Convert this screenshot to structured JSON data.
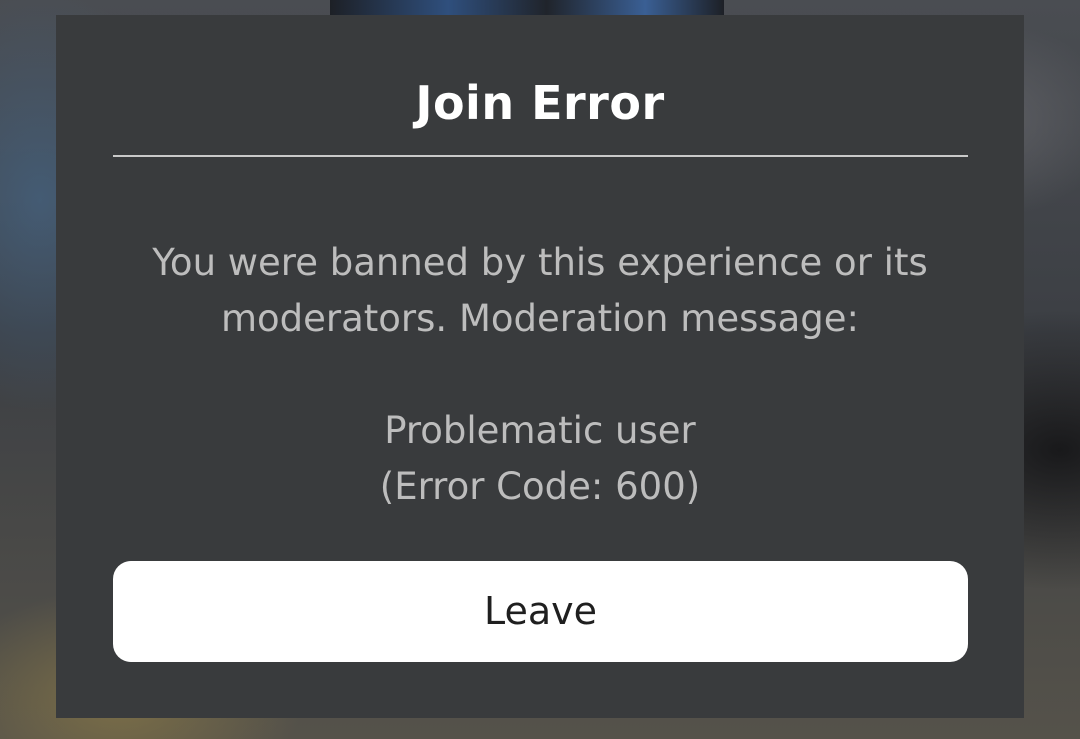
{
  "dialog": {
    "title": "Join Error",
    "message": "You were banned by this experience or its moderators. Moderation message:",
    "moderation_message": "Problematic user",
    "error_code_text": "(Error Code: 600)",
    "leave_label": "Leave"
  },
  "colors": {
    "modal_background": "#393b3d",
    "title_text": "#ffffff",
    "body_text": "#bdbdbd",
    "divider": "#c9c9c9",
    "button_background": "#ffffff",
    "button_text": "#1f1f1f"
  }
}
